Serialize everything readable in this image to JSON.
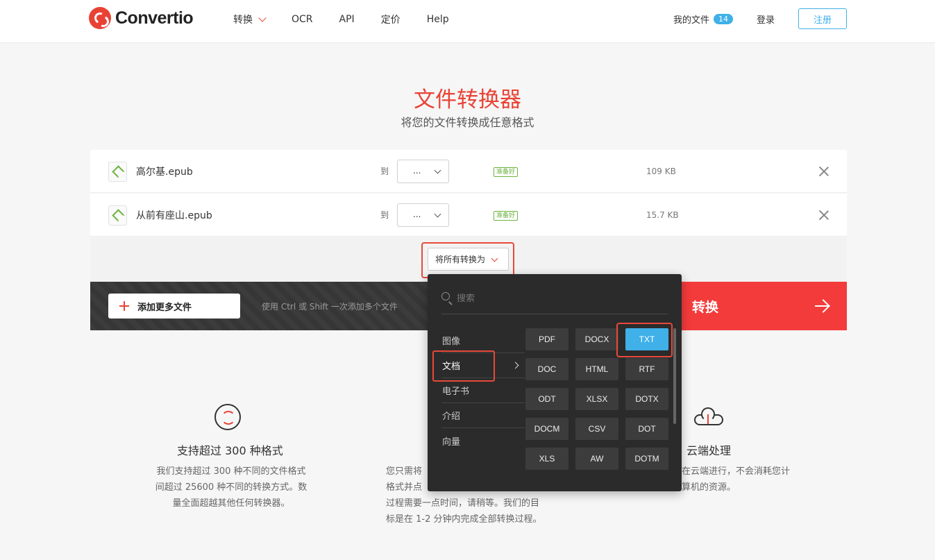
{
  "header": {
    "logo_text": "Convertio",
    "nav": [
      {
        "label": "转换",
        "has_dropdown": true
      },
      {
        "label": "OCR"
      },
      {
        "label": "API"
      },
      {
        "label": "定价"
      },
      {
        "label": "Help"
      }
    ],
    "my_files_label": "我的文件",
    "my_files_count": "14",
    "login_label": "登录",
    "signup_label": "注册"
  },
  "hero": {
    "title": "文件转换器",
    "subtitle": "将您的文件转换成任意格式"
  },
  "files": [
    {
      "name": "高尔基.epub",
      "to_label": "到",
      "format": "...",
      "status": "准备好",
      "size": "109 KB"
    },
    {
      "name": "从前有座山.epub",
      "to_label": "到",
      "format": "...",
      "status": "准备好",
      "size": "15.7 KB"
    }
  ],
  "convert_all_label": "将所有转换为",
  "actions": {
    "add_more_label": "添加更多文件",
    "add_hint": "使用 Ctrl 或 Shift 一次添加多个文件",
    "convert_label": "转换"
  },
  "dropdown": {
    "search_placeholder": "搜索",
    "categories": [
      "图像",
      "文档",
      "电子书",
      "介绍",
      "向量"
    ],
    "active_category": "文档",
    "formats": [
      "PDF",
      "DOCX",
      "TXT",
      "DOC",
      "HTML",
      "RTF",
      "ODT",
      "XLSX",
      "DOTX",
      "DOCM",
      "CSV",
      "DOT",
      "XLS",
      "AW",
      "DOTM"
    ],
    "selected_format": "TXT"
  },
  "features": [
    {
      "title": "支持超过 300 种格式",
      "lines": [
        "我们支持超过 300 种不同的文件格式",
        "间超过 25600 种不同的转换方式。数",
        "量全面超越其他任何转换器。"
      ]
    },
    {
      "title": "",
      "lines": [
        "您只需将",
        "格式并点",
        "过程需要一点时间，请稍等。我们的目",
        "标是在 1-2 分钟内完成全部转换过程。"
      ]
    },
    {
      "title": "云端处理",
      "lines": [
        "在云端进行，不会消耗您计",
        "算机的资源。"
      ]
    }
  ],
  "colors": {
    "brand_red": "#e94235",
    "convert_red": "#f33b3b",
    "accent_blue": "#3fb0e8",
    "ready_green": "#6cb33f"
  }
}
